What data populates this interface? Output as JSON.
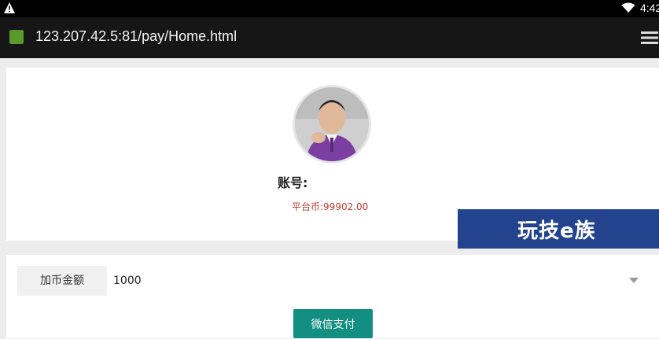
{
  "status_bar": {
    "time": "4:42",
    "icons": [
      "warning-icon",
      "wifi-icon"
    ]
  },
  "browser": {
    "url": "123.207.42.5:81/pay/Home.html",
    "icons": [
      "favicon-icon",
      "menu-icon"
    ]
  },
  "profile": {
    "account_label": "账号:",
    "balance_text": "平台币:99902.00",
    "balance_color": "#c0392b"
  },
  "watermark": {
    "text": "玩技e族",
    "background": "#23438e"
  },
  "recharge": {
    "amount_label": "加币金额",
    "amount_value": "1000",
    "pay_button_label": "微信支付",
    "button_color": "#138f82"
  }
}
